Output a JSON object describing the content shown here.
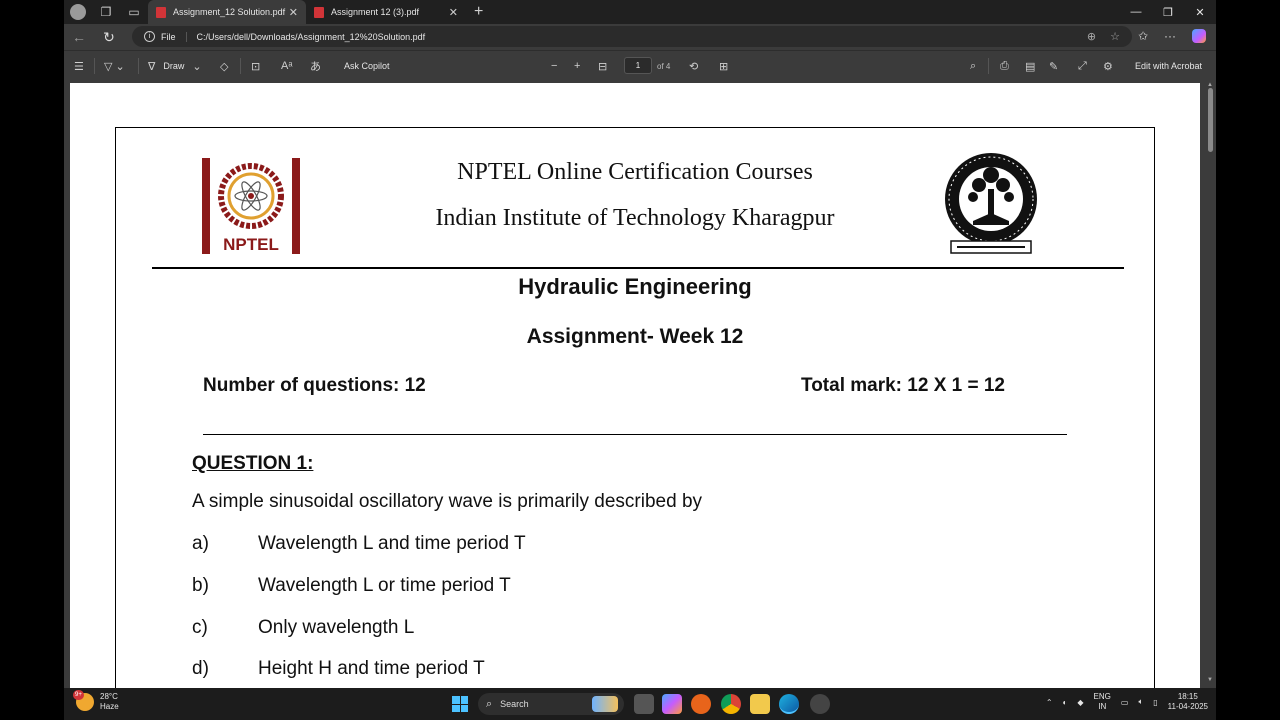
{
  "browser": {
    "tabs": [
      {
        "title": "Assignment_12 Solution.pdf",
        "active": true
      },
      {
        "title": "Assignment 12 (3).pdf",
        "active": false
      }
    ],
    "address": {
      "scheme_label": "File",
      "url": "C:/Users/dell/Downloads/Assignment_12%20Solution.pdf"
    }
  },
  "pdf_toolbar": {
    "draw_label": "Draw",
    "copilot_label": "Ask Copilot",
    "page_current": "1",
    "page_total": "of 4",
    "acrobat_label": "Edit with Acrobat"
  },
  "document": {
    "header_line1": "NPTEL Online Certification Courses",
    "header_line2": "Indian Institute of Technology Kharagpur",
    "nptel_logo_text": "NPTEL",
    "course": "Hydraulic Engineering",
    "week": "Assignment- Week 12",
    "num_questions": "Number of questions: 12",
    "total_mark": "Total mark: 12 X 1 = 12",
    "question_heading": "QUESTION 1:",
    "question_text": "A simple sinusoidal oscillatory wave is primarily described by",
    "options": [
      {
        "letter": "a)",
        "text": "Wavelength L and time period T"
      },
      {
        "letter": "b)",
        "text": "Wavelength L or time period T"
      },
      {
        "letter": "c)",
        "text": "Only wavelength L"
      },
      {
        "letter": "d)",
        "text": "Height H and time period T"
      }
    ]
  },
  "taskbar": {
    "weather_temp": "28°C",
    "weather_cond": "Haze",
    "weather_badge": "9+",
    "search_label": "Search",
    "lang_line1": "ENG",
    "lang_line2": "IN",
    "time": "18:15",
    "date": "11-04-2025"
  },
  "colors": {
    "pdf_red": "#d13438",
    "nptel_maroon": "#8b1a1a",
    "accent_blue": "#4cc2ff"
  }
}
